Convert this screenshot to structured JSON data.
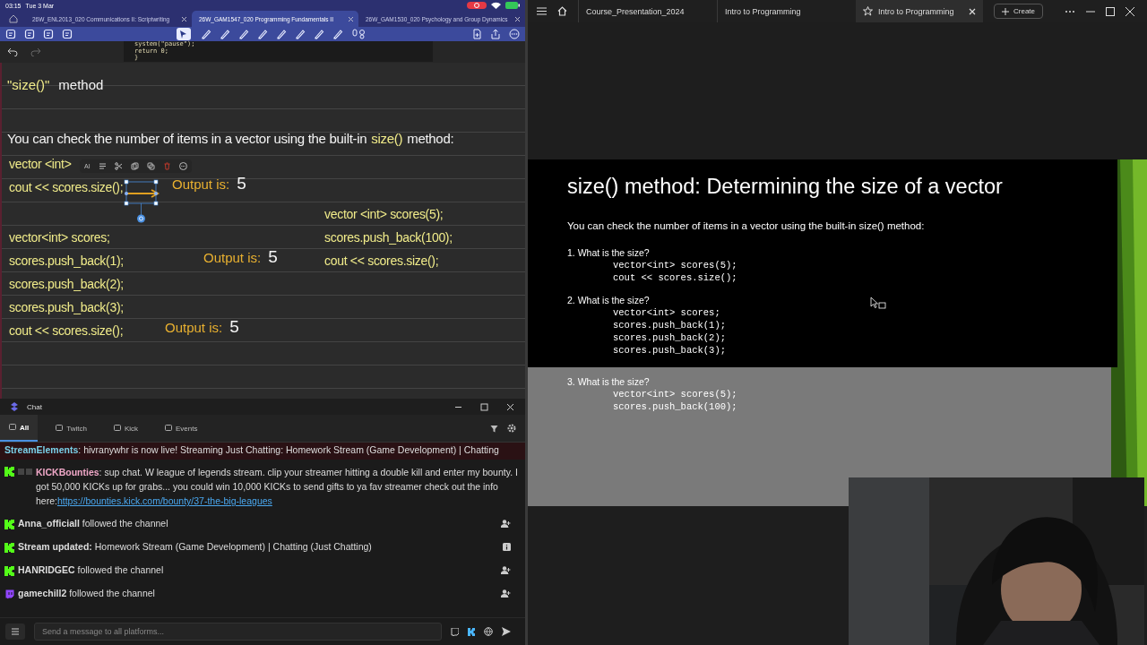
{
  "tablet": {
    "status": {
      "time": "03:15",
      "date": "Tue 3 Mar",
      "recording": true
    },
    "tabs": [
      {
        "label": "26W_ENL2013_020 Communications II: Scriptwriting",
        "selected": false
      },
      {
        "label": "26W_GAM1547_020 Programming Fundamentals II",
        "selected": true
      },
      {
        "label": "26W_GAM1530_020 Psychology and Group Dynamics",
        "selected": false
      }
    ],
    "code_snippet": [
      "system(\"pause\");",
      "return 0;",
      "}"
    ],
    "notes": {
      "heading": [
        {
          "text": "\"size()\"",
          "kind": "code"
        },
        {
          "text": "method",
          "kind": "plain"
        }
      ],
      "intro": [
        {
          "text": "You can check the number of items in a vector using the built-in",
          "kind": "plain"
        },
        {
          "text": "size()",
          "kind": "code"
        },
        {
          "text": "method:",
          "kind": "plain"
        }
      ],
      "blocks": [
        {
          "lines": [
            "vector <int>",
            "cout << scores.size();"
          ],
          "output": {
            "label": "Output is:",
            "value": "5"
          }
        },
        {
          "lines": [
            "vector<int>  scores;",
            "scores.push_back(1);",
            "scores.push_back(2);",
            "scores.push_back(3);",
            "cout << scores.size();"
          ],
          "output": {
            "label": "Output is:",
            "value": "5"
          }
        },
        {
          "lines": [
            "vector <int>  scores(5);",
            "scores.push_back(100);",
            "cout << scores.size();"
          ],
          "output": {
            "label": "Output is:",
            "value": "5"
          }
        }
      ],
      "selection_menu": {
        "ai_label": "AI"
      }
    }
  },
  "chat": {
    "title": "Chat",
    "tabs": [
      {
        "label": "All",
        "selected": true
      },
      {
        "label": "Twitch",
        "selected": false
      },
      {
        "label": "Kick",
        "selected": false
      },
      {
        "label": "Events",
        "selected": false
      }
    ],
    "messages": [
      {
        "kind": "announcement",
        "author": "StreamElements",
        "text": ": hivranywhr is now live! Streaming Just Chatting: Homework Stream (Game Development) | Chatting"
      },
      {
        "kind": "chat",
        "source": {
          "kind": "kick"
        },
        "author": "KICKBounties",
        "text": ": sup chat. W league of legends stream. clip your streamer hitting a double kill and enter my bounty. I got 50,000 KICKs up for grabs... you could win 10,000 KICKs to send gifts to ya fav streamer check out the info here:",
        "link": "https://bounties.kick.com/bounty/37-the-big-leagues"
      },
      {
        "kind": "follow",
        "source": {
          "kind": "kick"
        },
        "author": "Anna_officiall",
        "text": "followed the channel"
      },
      {
        "kind": "update",
        "source": {
          "kind": "kick"
        },
        "author": "Stream updated:",
        "text": "Homework Stream (Game Development) | Chatting (Just Chatting)"
      },
      {
        "kind": "follow",
        "source": {
          "kind": "kick"
        },
        "author": "HANRIDGEC",
        "text": "followed the channel"
      },
      {
        "kind": "follow",
        "source": {
          "kind": "twitch"
        },
        "author": "gamechill2",
        "text": "followed the channel"
      }
    ],
    "input": {
      "placeholder": "Send a message to all platforms..."
    }
  },
  "viewer": {
    "tabs": [
      {
        "label": "Course_Presentation_2024",
        "starred": false,
        "selected": false
      },
      {
        "label": "Intro to Programming",
        "starred": false,
        "selected": false
      },
      {
        "label": "Intro to Programming",
        "starred": true,
        "selected": true
      }
    ],
    "create_label": "Create",
    "slide": {
      "title": "size() method: Determining the size of a vector",
      "intro": "You can check the number of items in a vector using the built-in size() method:",
      "questions": [
        {
          "label": "1. What is the size?",
          "code": [
            "vector<int> scores(5);",
            "cout << scores.size();"
          ]
        },
        {
          "label": "2. What is the size?",
          "code": [
            "vector<int> scores;",
            "scores.push_back(1);",
            "scores.push_back(2);",
            "scores.push_back(3);"
          ]
        },
        {
          "label": "3. What is the size?",
          "code": [
            "vector<int> scores(5);",
            "scores.push_back(100);"
          ]
        }
      ]
    }
  }
}
